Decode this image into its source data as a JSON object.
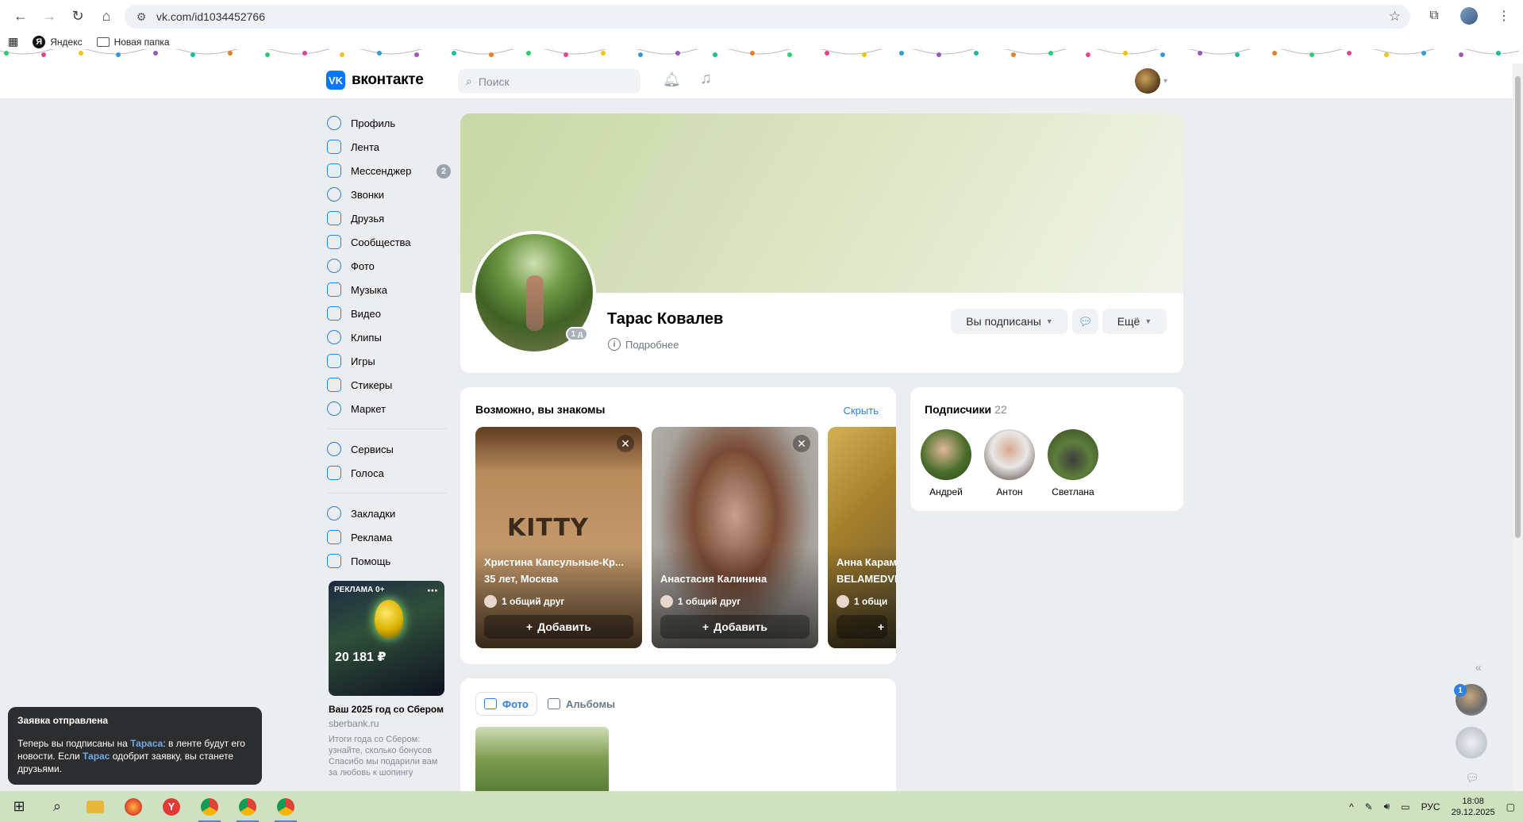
{
  "browser": {
    "url": "vk.com/id1034452766",
    "bookmarks": [
      "Яндекс",
      "Новая папка"
    ]
  },
  "vk_header": {
    "logo_text": "вконтакте",
    "search_placeholder": "Поиск"
  },
  "nav": {
    "items": [
      {
        "label": "Профиль",
        "icon": "profile-icon"
      },
      {
        "label": "Лента",
        "icon": "news-icon"
      },
      {
        "label": "Мессенджер",
        "icon": "messenger-icon",
        "count": "2"
      },
      {
        "label": "Звонки",
        "icon": "phone-icon"
      },
      {
        "label": "Друзья",
        "icon": "friends-icon"
      },
      {
        "label": "Сообщества",
        "icon": "communities-icon"
      },
      {
        "label": "Фото",
        "icon": "photo-icon"
      },
      {
        "label": "Музыка",
        "icon": "music-icon"
      },
      {
        "label": "Видео",
        "icon": "video-icon"
      },
      {
        "label": "Клипы",
        "icon": "clips-icon"
      },
      {
        "label": "Игры",
        "icon": "games-icon"
      },
      {
        "label": "Стикеры",
        "icon": "stickers-icon"
      },
      {
        "label": "Маркет",
        "icon": "market-icon"
      }
    ],
    "items2": [
      {
        "label": "Сервисы",
        "icon": "services-icon"
      },
      {
        "label": "Голоса",
        "icon": "votes-icon"
      }
    ],
    "items3": [
      {
        "label": "Закладки",
        "icon": "bookmarks-icon"
      },
      {
        "label": "Реклама",
        "icon": "ads-icon"
      },
      {
        "label": "Помощь",
        "icon": "help-icon"
      }
    ]
  },
  "ad": {
    "tag": "РЕКЛАМА 0+",
    "price": "20 181 ₽",
    "title": "Ваш 2025 год со Сбером",
    "domain": "sberbank.ru",
    "desc": "Итоги года со Сбером: узнайте, сколько бонусов Спасибо мы подарили вам за любовь к шопингу"
  },
  "profile": {
    "name": "Тарас Ковалев",
    "online": "1 д",
    "more_link": "Подробнее",
    "subscribed_btn": "Вы подписаны",
    "more_btn": "Ещё"
  },
  "suggestions": {
    "title": "Возможно, вы знакомы",
    "hide": "Скрыть",
    "add_label": "Добавить",
    "people": [
      {
        "name": "Христина Капсульные-Кр...",
        "desc": "35 лет, Москва",
        "mutual": "1 общий друг"
      },
      {
        "name": "Анастасия Калинина",
        "desc": "",
        "mutual": "1 общий друг"
      },
      {
        "name": "Анна Карам",
        "desc": "BELAMEDVE",
        "mutual": "1 общи"
      }
    ]
  },
  "photos": {
    "tab_photos": "Фото",
    "tab_albums": "Альбомы"
  },
  "subscribers": {
    "title": "Подписчики",
    "count": "22",
    "people": [
      {
        "name": "Андрей"
      },
      {
        "name": "Антон"
      },
      {
        "name": "Светлана"
      }
    ]
  },
  "chat": {
    "unread": "1"
  },
  "toast": {
    "title": "Заявка отправлена",
    "part1": "Теперь вы подписаны на ",
    "name1": "Тараса",
    "part2": ": в ленте будут его новости. Если ",
    "name2": "Тарас",
    "part3": " одобрит заявку, вы станете друзьями."
  },
  "tray": {
    "lang": "РУС",
    "time": "18:08",
    "date": "29.12.2025"
  },
  "colors": {
    "accent": "#2d81e0",
    "vk_blue": "#0077ff",
    "page_bg": "#ebedf0"
  }
}
